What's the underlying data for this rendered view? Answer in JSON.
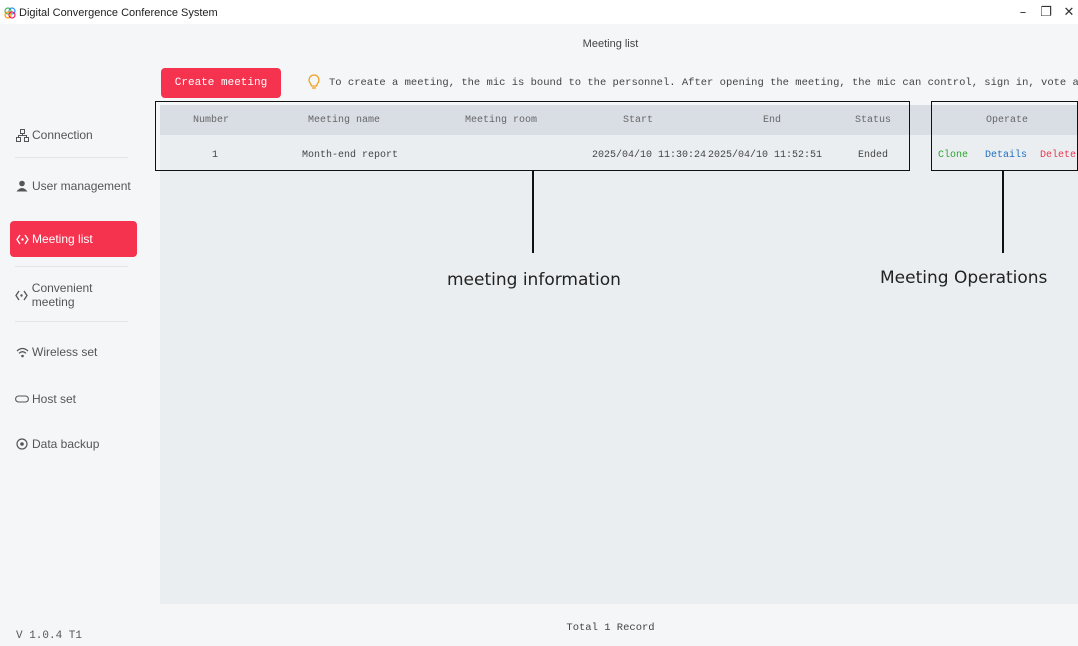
{
  "window": {
    "title": "Digital Convergence Conference System",
    "minimize": "–",
    "restore": "❐",
    "close": "✕"
  },
  "sidebar": {
    "items": [
      {
        "label": "Connection",
        "icon": "network-icon"
      },
      {
        "label": "User management",
        "icon": "user-icon"
      },
      {
        "label": "Meeting list",
        "icon": "meeting-icon",
        "active": true
      },
      {
        "label": "Convenient meeting",
        "icon": "meeting-icon"
      },
      {
        "label": "Wireless set",
        "icon": "wifi-icon"
      },
      {
        "label": "Host set",
        "icon": "host-icon"
      },
      {
        "label": "Data backup",
        "icon": "backup-icon"
      }
    ],
    "version": "V 1.0.4 T1"
  },
  "main": {
    "title": "Meeting list",
    "create_button": "Create meeting",
    "tip": "To create a meeting, the mic is bound to the personnel. After opening the meeting, the mic can control, sign in, vote and call",
    "table": {
      "headers": [
        "Number",
        "Meeting name",
        "Meeting room",
        "Start",
        "End",
        "Status",
        "Operate"
      ],
      "rows": [
        {
          "number": "1",
          "name": "Month-end report",
          "room": "",
          "start": "2025/04/10 11:30:24",
          "end": "2025/04/10 11:52:51",
          "status": "Ended",
          "actions": [
            "Clone",
            "Details",
            "Delete"
          ]
        }
      ]
    },
    "footer": "Total 1 Record"
  },
  "annotations": {
    "meeting_info": "meeting information",
    "meeting_ops": "Meeting Operations"
  },
  "colors": {
    "accent": "#f5334f",
    "clone": "#2aa52a",
    "details": "#1f6fc2",
    "delete": "#e8384f"
  }
}
